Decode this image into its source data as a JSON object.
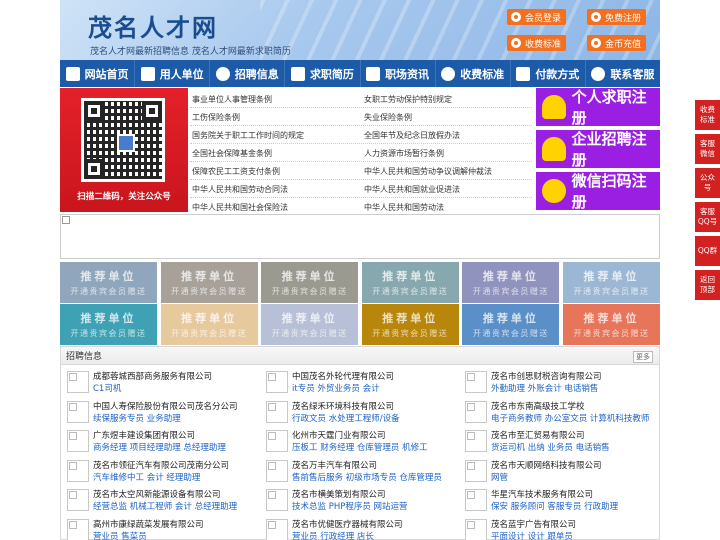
{
  "header": {
    "logo": "茂名人才网",
    "slogan": "茂名人才网最新招聘信息   茂名人才网最新求职简历",
    "buttons": [
      {
        "label": "会员登录"
      },
      {
        "label": "免费注册"
      },
      {
        "label": "收费标准"
      },
      {
        "label": "金币充值"
      }
    ]
  },
  "nav": [
    {
      "label": "网站首页",
      "icon": "home-icon"
    },
    {
      "label": "用人单位",
      "icon": "building-icon"
    },
    {
      "label": "招聘信息",
      "icon": "megaphone-icon"
    },
    {
      "label": "求职简历",
      "icon": "edit-icon"
    },
    {
      "label": "职场资讯",
      "icon": "news-icon"
    },
    {
      "label": "收费标准",
      "icon": "coins-icon"
    },
    {
      "label": "付款方式",
      "icon": "card-icon"
    },
    {
      "label": "联系客服",
      "icon": "phone-icon"
    }
  ],
  "qr": {
    "caption": "扫描二维码，关注公众号"
  },
  "links": {
    "left": [
      "事业单位人事管理条例",
      "工伤保险条例",
      "国务院关于职工工作时间的规定",
      "全国社会保障基金条例",
      "保障农民工工资支付条例",
      "中华人民共和国劳动合同法",
      "中华人民共和国社会保险法"
    ],
    "right": [
      "女职工劳动保护特别规定",
      "失业保险条例",
      "全国年节及纪念日放假办法",
      "人力资源市场暂行条例",
      "中华人民共和国劳动争议调解仲裁法",
      "中华人民共和国就业促进法",
      "中华人民共和国劳动法"
    ]
  },
  "register": [
    {
      "label": "个人求职注册"
    },
    {
      "label": "企业招聘注册"
    },
    {
      "label": "微信扫码注册"
    }
  ],
  "recommend": {
    "title": "推荐单位",
    "subtitle": "开通贵宾会员赠送",
    "colors": [
      "#8fa6bc",
      "#a8a19a",
      "#9b9a90",
      "#88a8b0",
      "#8f93be",
      "#9cb7d4",
      "#3fa1b4",
      "#e7c99e",
      "#b7c0d6",
      "#b8860b",
      "#5a8fc7",
      "#e6755a"
    ]
  },
  "jobs": {
    "title": "招聘信息",
    "more": "更多",
    "items": [
      {
        "company": "成都蓉城西部商务服务有限公司",
        "positions": "C1司机"
      },
      {
        "company": "中国茂名外轮代理有限公司",
        "positions": "it专员 外贸业务员 会计"
      },
      {
        "company": "茂名市创思财税咨询有限公司",
        "positions": "外勤助理 外账会计 电话销售"
      },
      {
        "company": "中国人寿保险股份有限公司茂名分公司",
        "positions": "续保服务专员 业务助理"
      },
      {
        "company": "茂名绿禾环境科技有限公司",
        "positions": "行政文员 水处理工程师/设备"
      },
      {
        "company": "茂名市东南高级技工学校",
        "positions": "电子商务教师 办公室文员 计算机科技教师"
      },
      {
        "company": "广东煜丰建设集团有限公司",
        "positions": "商务经理 项目经理助理 总经理助理"
      },
      {
        "company": "化州市天霆门业有限公司",
        "positions": "压板工 财务经理 仓库管理员 机修工"
      },
      {
        "company": "茂名市至汇贸易有限公司",
        "positions": "货运司机 出纳 业务员 电话销售"
      },
      {
        "company": "茂名市领征汽车有限公司茂南分公司",
        "positions": "汽车维修中工 会计 经理助理"
      },
      {
        "company": "茂名万丰汽车有限公司",
        "positions": "售前售后服务 初级市场专员 仓库管理员"
      },
      {
        "company": "茂名市天顺网络科技有限公司",
        "positions": "网管"
      },
      {
        "company": "茂名市太空风新能源设备有限公司",
        "positions": "经营总监 机械工程师 会计 总经理助理"
      },
      {
        "company": "茂名市横美策划有限公司",
        "positions": "技术总监 PHP程序员 网站运营"
      },
      {
        "company": "华星汽车技术服务有限公司",
        "positions": "保安 服务顾问 客服专员 行政助理"
      },
      {
        "company": "高州市康绿蔬菜发展有限公司",
        "positions": "营业员 售菜员"
      },
      {
        "company": "茂名市优健医疗器械有限公司",
        "positions": "营业员 行政经理 店长"
      },
      {
        "company": "茂名蓝宇广告有限公司",
        "positions": "平面设计 设计 跟单员"
      }
    ]
  },
  "side": [
    {
      "label": "收费标准"
    },
    {
      "label": "客服微信"
    },
    {
      "label": "公众号"
    },
    {
      "label": "客服QQ号"
    },
    {
      "label": "QQ群"
    },
    {
      "label": "返回顶部"
    }
  ]
}
